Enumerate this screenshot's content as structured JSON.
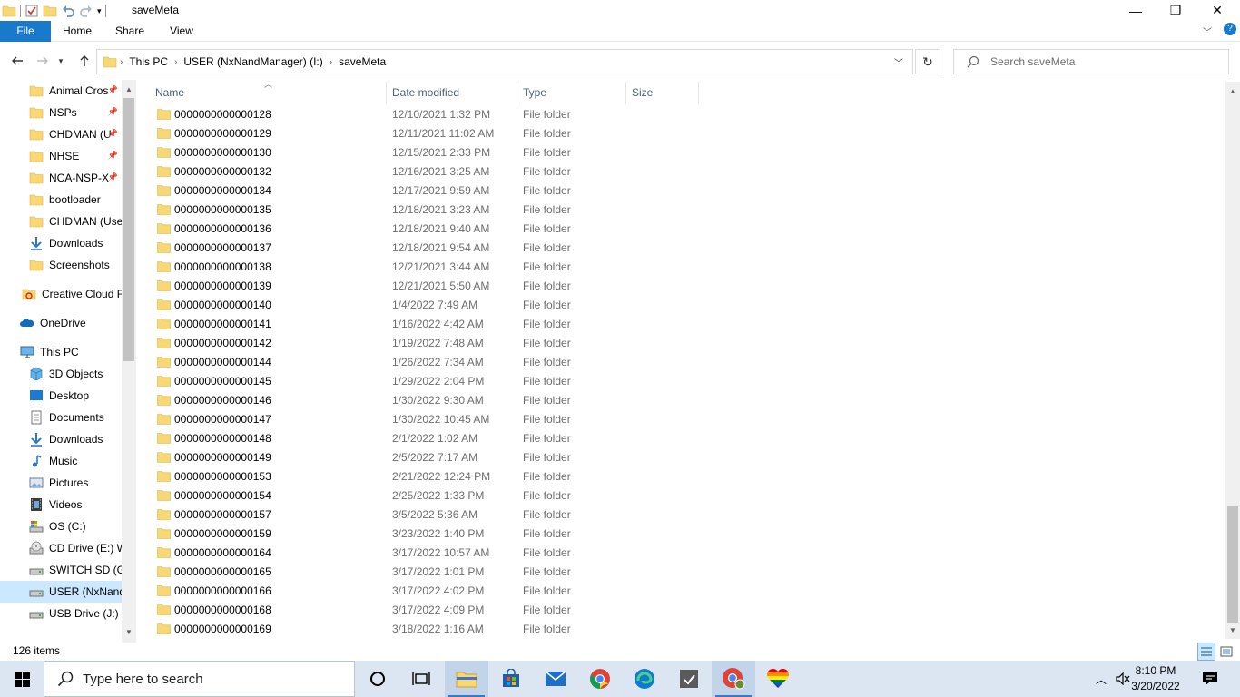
{
  "window": {
    "title": "saveMeta",
    "minimize_glyph": "—",
    "maximize_glyph": "❐",
    "close_glyph": "✕"
  },
  "ribbon": {
    "tabs": [
      "File",
      "Home",
      "Share",
      "View"
    ]
  },
  "address": {
    "crumbs": [
      "This PC",
      "USER (NxNandManager) (I:)",
      "saveMeta"
    ],
    "search_placeholder": "Search saveMeta"
  },
  "nav_pane": {
    "items": [
      {
        "label": "Animal Cros",
        "icon": "folder-icon",
        "pinned": true
      },
      {
        "label": "NSPs",
        "icon": "folder-icon",
        "pinned": true
      },
      {
        "label": "CHDMAN (U",
        "icon": "folder-icon",
        "pinned": true
      },
      {
        "label": "NHSE",
        "icon": "folder-icon",
        "pinned": true
      },
      {
        "label": "NCA-NSP-X",
        "icon": "folder-icon",
        "pinned": true
      },
      {
        "label": "bootloader",
        "icon": "folder-icon",
        "pinned": false
      },
      {
        "label": "CHDMAN (Use",
        "icon": "folder-icon",
        "pinned": false
      },
      {
        "label": "Downloads",
        "icon": "downloads-icon",
        "pinned": false
      },
      {
        "label": "Screenshots",
        "icon": "folder-icon",
        "pinned": false
      },
      {
        "label": "Creative Cloud F",
        "icon": "creative-cloud-icon",
        "pinned": false
      },
      {
        "label": "OneDrive",
        "icon": "onedrive-icon",
        "pinned": false
      },
      {
        "label": "This PC",
        "icon": "this-pc-icon",
        "pinned": false
      },
      {
        "label": "3D Objects",
        "icon": "3d-objects-icon",
        "pinned": false
      },
      {
        "label": "Desktop",
        "icon": "desktop-icon",
        "pinned": false
      },
      {
        "label": "Documents",
        "icon": "documents-icon",
        "pinned": false
      },
      {
        "label": "Downloads",
        "icon": "downloads-icon",
        "pinned": false
      },
      {
        "label": "Music",
        "icon": "music-icon",
        "pinned": false
      },
      {
        "label": "Pictures",
        "icon": "pictures-icon",
        "pinned": false
      },
      {
        "label": "Videos",
        "icon": "videos-icon",
        "pinned": false
      },
      {
        "label": "OS (C:)",
        "icon": "os-drive-icon",
        "pinned": false
      },
      {
        "label": "CD Drive (E:) W",
        "icon": "cd-drive-icon",
        "pinned": false
      },
      {
        "label": "SWITCH SD (G:)",
        "icon": "drive-icon",
        "pinned": false
      },
      {
        "label": "USER (NxNandI",
        "icon": "drive-icon",
        "pinned": false,
        "selected": true
      },
      {
        "label": "USB Drive (J:)",
        "icon": "drive-icon",
        "pinned": false
      }
    ]
  },
  "columns": [
    "Name",
    "Date modified",
    "Type",
    "Size"
  ],
  "files": [
    {
      "name": "0000000000000128",
      "date": "12/10/2021 1:32 PM",
      "type": "File folder"
    },
    {
      "name": "0000000000000129",
      "date": "12/11/2021 11:02 AM",
      "type": "File folder"
    },
    {
      "name": "0000000000000130",
      "date": "12/15/2021 2:33 PM",
      "type": "File folder"
    },
    {
      "name": "0000000000000132",
      "date": "12/16/2021 3:25 AM",
      "type": "File folder"
    },
    {
      "name": "0000000000000134",
      "date": "12/17/2021 9:59 AM",
      "type": "File folder"
    },
    {
      "name": "0000000000000135",
      "date": "12/18/2021 3:23 AM",
      "type": "File folder"
    },
    {
      "name": "0000000000000136",
      "date": "12/18/2021 9:40 AM",
      "type": "File folder"
    },
    {
      "name": "0000000000000137",
      "date": "12/18/2021 9:54 AM",
      "type": "File folder"
    },
    {
      "name": "0000000000000138",
      "date": "12/21/2021 3:44 AM",
      "type": "File folder"
    },
    {
      "name": "0000000000000139",
      "date": "12/21/2021 5:50 AM",
      "type": "File folder"
    },
    {
      "name": "0000000000000140",
      "date": "1/4/2022 7:49 AM",
      "type": "File folder"
    },
    {
      "name": "0000000000000141",
      "date": "1/16/2022 4:42 AM",
      "type": "File folder"
    },
    {
      "name": "0000000000000142",
      "date": "1/19/2022 7:48 AM",
      "type": "File folder"
    },
    {
      "name": "0000000000000144",
      "date": "1/26/2022 7:34 AM",
      "type": "File folder"
    },
    {
      "name": "0000000000000145",
      "date": "1/29/2022 2:04 PM",
      "type": "File folder"
    },
    {
      "name": "0000000000000146",
      "date": "1/30/2022 9:30 AM",
      "type": "File folder"
    },
    {
      "name": "0000000000000147",
      "date": "1/30/2022 10:45 AM",
      "type": "File folder"
    },
    {
      "name": "0000000000000148",
      "date": "2/1/2022 1:02 AM",
      "type": "File folder"
    },
    {
      "name": "0000000000000149",
      "date": "2/5/2022 7:17 AM",
      "type": "File folder"
    },
    {
      "name": "0000000000000153",
      "date": "2/21/2022 12:24 PM",
      "type": "File folder"
    },
    {
      "name": "0000000000000154",
      "date": "2/25/2022 1:33 PM",
      "type": "File folder"
    },
    {
      "name": "0000000000000157",
      "date": "3/5/2022 5:36 AM",
      "type": "File folder"
    },
    {
      "name": "0000000000000159",
      "date": "3/23/2022 1:40 PM",
      "type": "File folder"
    },
    {
      "name": "0000000000000164",
      "date": "3/17/2022 10:57 AM",
      "type": "File folder"
    },
    {
      "name": "0000000000000165",
      "date": "3/17/2022 1:01 PM",
      "type": "File folder"
    },
    {
      "name": "0000000000000166",
      "date": "3/17/2022 4:02 PM",
      "type": "File folder"
    },
    {
      "name": "0000000000000168",
      "date": "3/17/2022 4:09 PM",
      "type": "File folder"
    },
    {
      "name": "0000000000000169",
      "date": "3/18/2022 1:16 AM",
      "type": "File folder"
    }
  ],
  "status": {
    "item_count": "126 items"
  },
  "taskbar": {
    "search_placeholder": "Type here to search",
    "apps": [
      "cortana-icon",
      "task-view-icon",
      "file-explorer-icon",
      "microsoft-store-icon",
      "mail-icon",
      "chrome-icon",
      "edge-icon",
      "app-icon",
      "chrome-profile-icon",
      "pride-heart-icon"
    ],
    "time": "8:10 PM",
    "date": "3/20/2022"
  },
  "colors": {
    "accent": "#1979ca",
    "folder": "#f8d775",
    "selection": "#cce8ff",
    "taskbar": "#dce6f2"
  }
}
